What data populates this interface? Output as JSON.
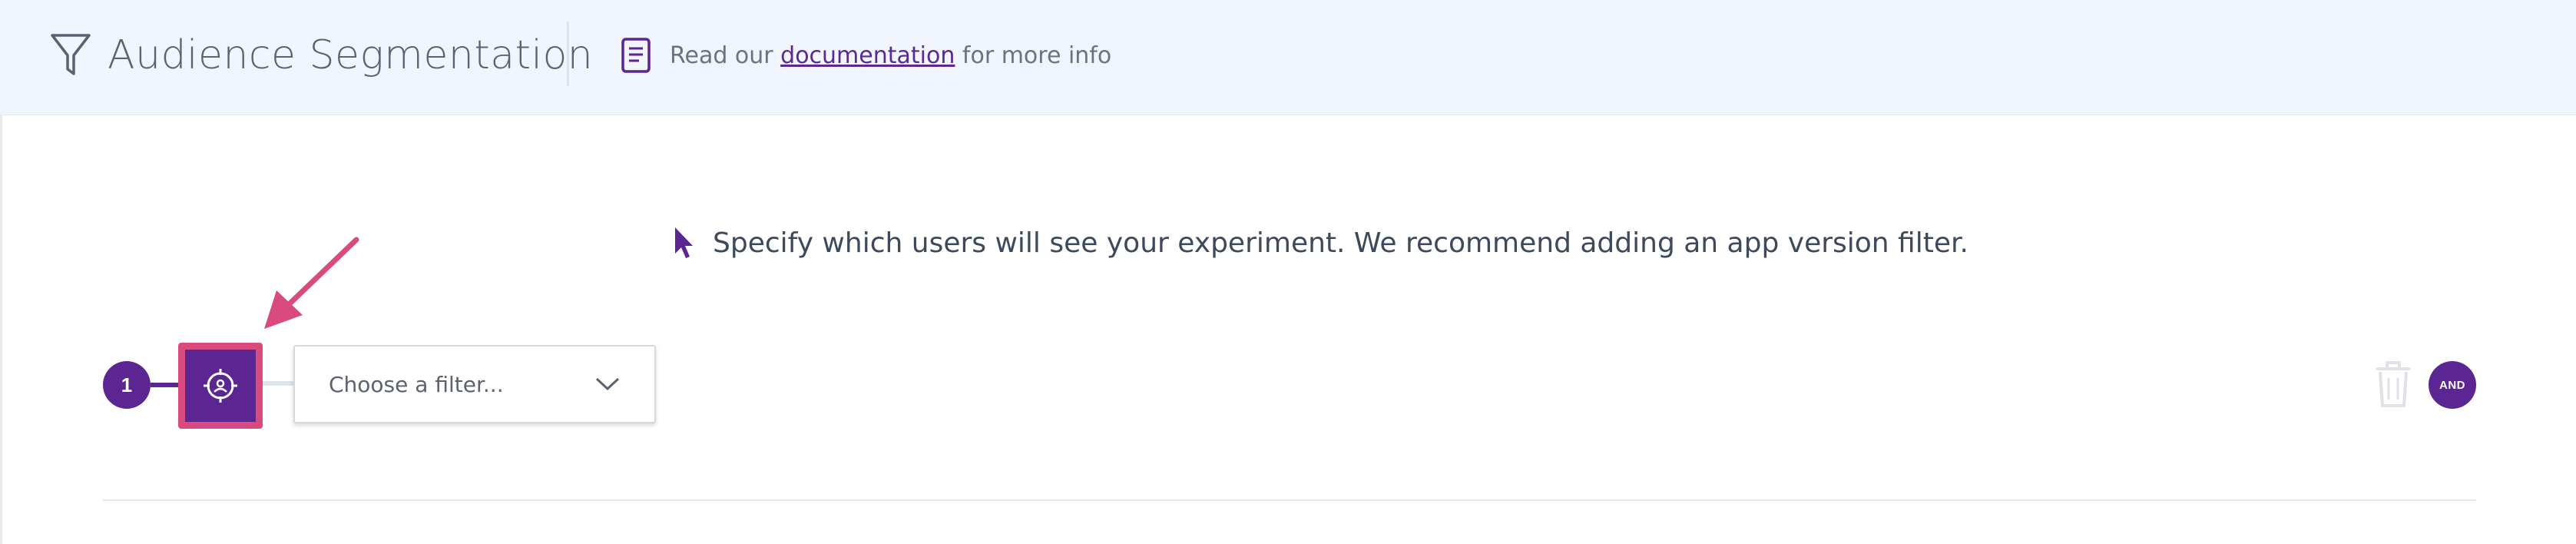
{
  "header": {
    "title": "Audience Segmentation",
    "doc_prefix": "Read our ",
    "doc_link": "documentation",
    "doc_suffix": " for more info",
    "icons": [
      "filter-funnel-icon",
      "document-icon"
    ]
  },
  "main": {
    "instruction": "Specify which users will see your experiment. We recommend adding an app version filter.",
    "cursor_icon": "pointer-cursor-icon"
  },
  "filter_row": {
    "step_number": "1",
    "target_icon": "crosshair-target-icon",
    "filter_placeholder": "Choose a filter...",
    "and_label": "AND",
    "trash_icon": "trash-icon"
  },
  "colors": {
    "accent": "#5b2592",
    "highlight": "#d94a7e",
    "header_bg": "#f1f5fd",
    "link": "#5b2a91"
  }
}
